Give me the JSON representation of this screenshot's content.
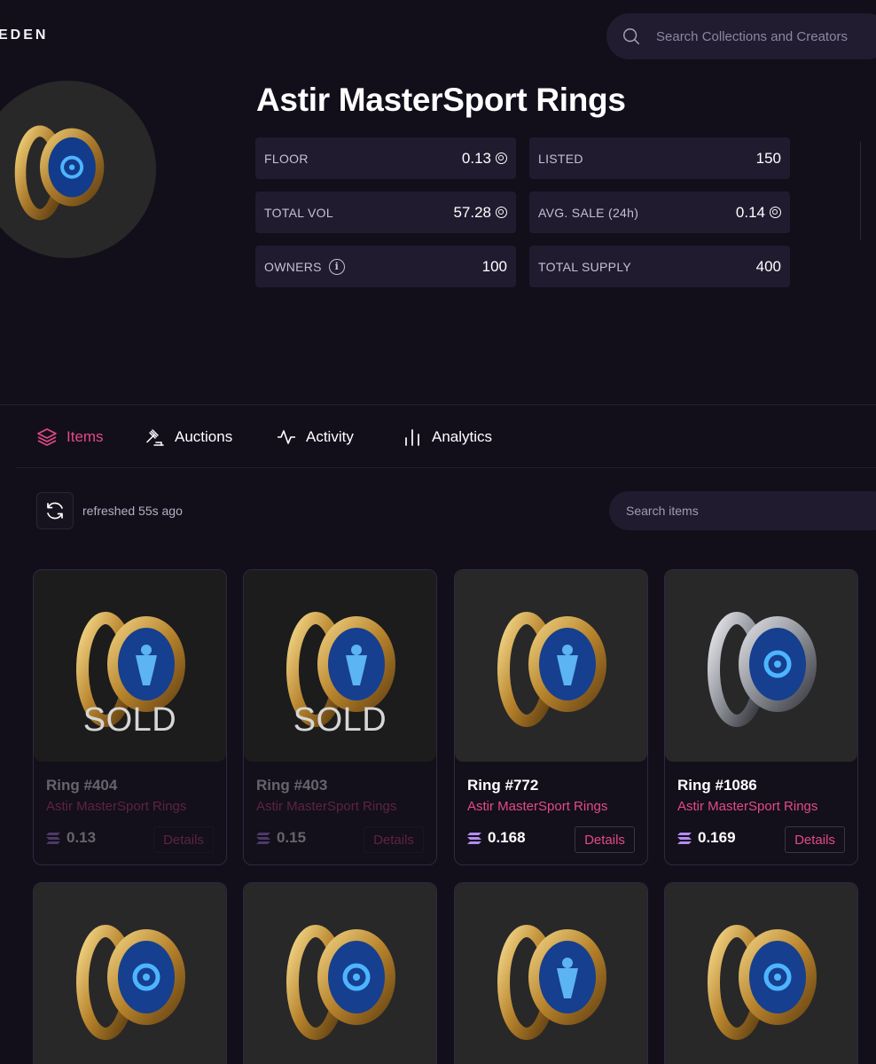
{
  "header": {
    "brand": "EDEN",
    "search_placeholder": "Search Collections and Creators"
  },
  "collection": {
    "title": "Astir MasterSport Rings",
    "stats": {
      "floor": {
        "label": "FLOOR",
        "value": "0.13"
      },
      "listed": {
        "label": "LISTED",
        "value": "150"
      },
      "total_vol": {
        "label": "TOTAL VOL",
        "value": "57.28"
      },
      "avg_sale": {
        "label": "AVG. SALE (24h)",
        "value": "0.14"
      },
      "owners": {
        "label": "OWNERS",
        "value": "100"
      },
      "total_supply": {
        "label": "TOTAL SUPPLY",
        "value": "400"
      }
    }
  },
  "tabs": [
    {
      "label": "Items",
      "icon": "layers-icon",
      "active": true
    },
    {
      "label": "Auctions",
      "icon": "gavel-icon",
      "active": false
    },
    {
      "label": "Activity",
      "icon": "activity-icon",
      "active": false
    },
    {
      "label": "Analytics",
      "icon": "bar-chart-icon",
      "active": false
    }
  ],
  "toolbar": {
    "refresh_text": "refreshed 55s ago",
    "search_items_placeholder": "Search items"
  },
  "items": [
    {
      "name": "Ring #404",
      "collection": "Astir MasterSport Rings",
      "price": "0.13",
      "details_label": "Details",
      "sold_label": "SOLD",
      "metal": "gold",
      "emblem": "figure"
    },
    {
      "name": "Ring #403",
      "collection": "Astir MasterSport Rings",
      "price": "0.15",
      "details_label": "Details",
      "sold_label": "SOLD",
      "metal": "gold",
      "emblem": "figure"
    },
    {
      "name": "Ring #772",
      "collection": "Astir MasterSport Rings",
      "price": "0.168",
      "details_label": "Details",
      "metal": "gold",
      "emblem": "figure"
    },
    {
      "name": "Ring #1086",
      "collection": "Astir MasterSport Rings",
      "price": "0.169",
      "details_label": "Details",
      "metal": "silver",
      "emblem": "logo"
    },
    {
      "metal": "gold",
      "emblem": "logo"
    },
    {
      "metal": "gold",
      "emblem": "logo"
    },
    {
      "metal": "gold",
      "emblem": "figure"
    },
    {
      "metal": "gold",
      "emblem": "logo"
    }
  ],
  "colors": {
    "background": "#120f1b",
    "panel": "#211b2f",
    "accent": "#e34a86"
  }
}
